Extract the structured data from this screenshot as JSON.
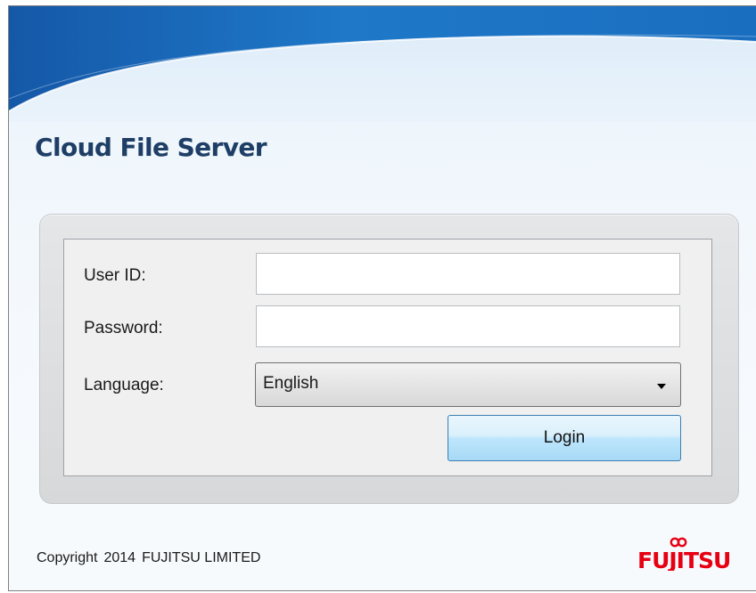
{
  "app": {
    "title": "Cloud File Server"
  },
  "login_form": {
    "user_id_label": "User ID:",
    "user_id_value": "",
    "password_label": "Password:",
    "password_value": "",
    "language_label": "Language:",
    "language_selected": "English",
    "login_button_label": "Login"
  },
  "footer": {
    "copyright_word": "Copyright",
    "copyright_year": "2014",
    "copyright_company": "FUJITSU LIMITED",
    "logo_text": "FUJITSU",
    "logo_color": "#e60012"
  },
  "colors": {
    "title": "#1e3e66",
    "banner_blue": "#1a6fc0",
    "button_border": "#3c7fb1"
  },
  "icons": {
    "language_dropdown": "chevron-down-icon",
    "logo": "fujitsu-logo"
  }
}
